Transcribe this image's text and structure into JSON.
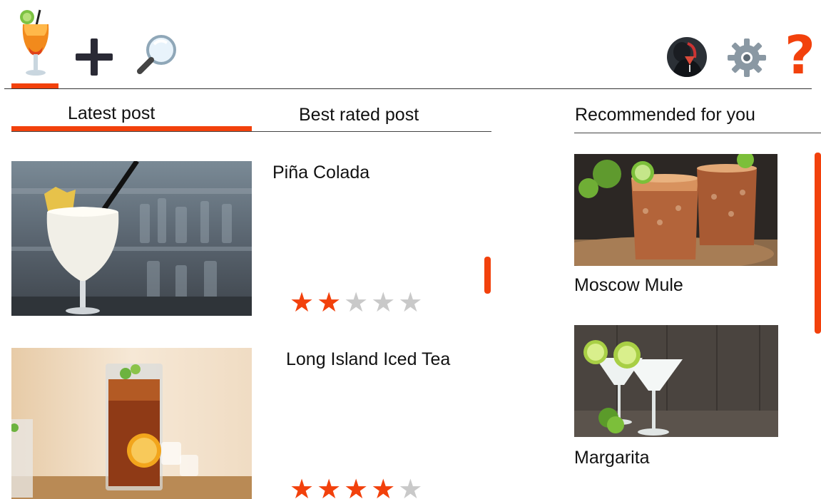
{
  "toolbar": {
    "home_icon": "cocktail-glass-icon",
    "add_icon": "plus-icon",
    "search_icon": "magnifier-icon",
    "profile_icon": "avatar",
    "settings_icon": "gear-icon",
    "help_label": "?"
  },
  "tabs": [
    {
      "label": "Latest post",
      "active": true
    },
    {
      "label": "Best rated post",
      "active": false
    }
  ],
  "recommended": {
    "heading": "Recommended for you",
    "items": [
      {
        "title": "Moscow Mule"
      },
      {
        "title": "Margarita"
      }
    ]
  },
  "posts": [
    {
      "title": "Piña Colada",
      "rating": 2,
      "max_rating": 5
    },
    {
      "title": "Long Island Iced Tea",
      "rating": 4,
      "max_rating": 5
    }
  ],
  "colors": {
    "accent": "#f2410c",
    "star_off": "#c9c9c9"
  }
}
